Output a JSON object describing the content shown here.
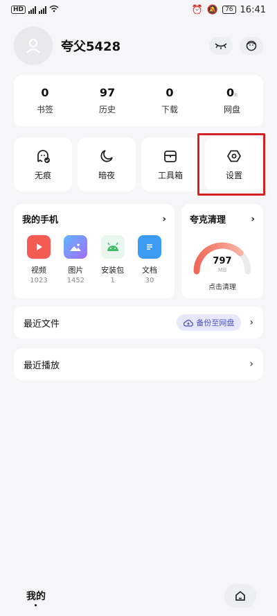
{
  "statusbar": {
    "left": "HD 26 46",
    "battery": "76",
    "time": "16:41"
  },
  "profile": {
    "username": "夸父5428"
  },
  "stats": [
    {
      "num": "0",
      "label": "书签"
    },
    {
      "num": "97",
      "label": "历史"
    },
    {
      "num": "0",
      "label": "下载"
    },
    {
      "num": "0",
      "unit": "B",
      "label": "网盘"
    }
  ],
  "tools": [
    {
      "label": "无痕",
      "icon": "ghost-icon"
    },
    {
      "label": "暗夜",
      "icon": "moon-icon"
    },
    {
      "label": "工具箱",
      "icon": "toolbox-icon"
    },
    {
      "label": "设置",
      "icon": "settings-hexagon-icon"
    }
  ],
  "my_phone": {
    "title": "我的手机",
    "apps": [
      {
        "label": "视频",
        "count": "1023",
        "color": "#f45b52"
      },
      {
        "label": "图片",
        "count": "1452",
        "color": "#7b7df2"
      },
      {
        "label": "安装包",
        "count": "1",
        "color": "#3fbf6a"
      },
      {
        "label": "文档",
        "count": "30",
        "color": "#3c9cf1"
      }
    ]
  },
  "clean": {
    "title": "夸克清理",
    "value": "797",
    "unit": "MB",
    "action": "点击清理",
    "fill_fraction": 0.75
  },
  "recent_files": {
    "title": "最近文件",
    "backup_label": "备份至网盘"
  },
  "recent_play": {
    "title": "最近播放"
  },
  "bottomnav": {
    "mine_label": "我的"
  },
  "colors": {
    "highlight": "#d32020",
    "accent": "#4a4fc9"
  }
}
